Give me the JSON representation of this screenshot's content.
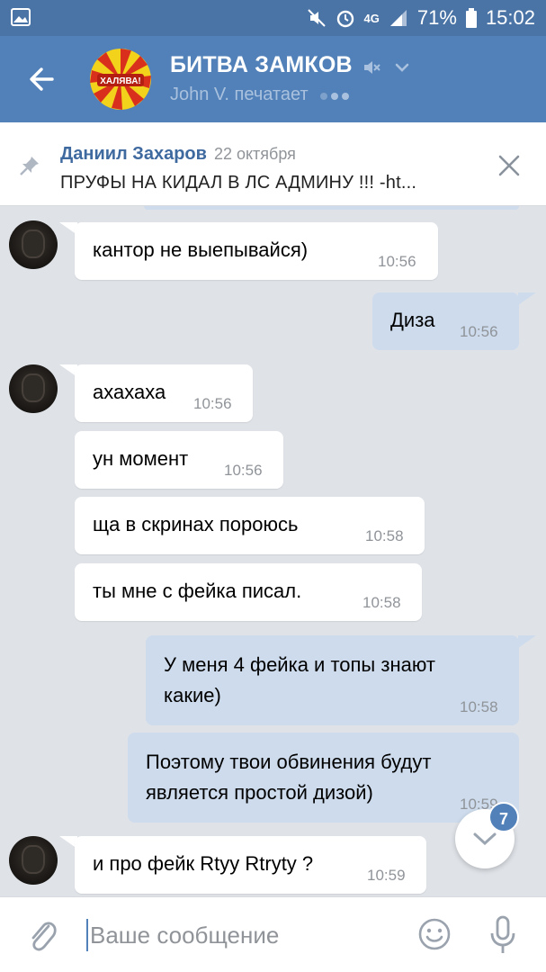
{
  "status_bar": {
    "network": "4G",
    "battery": "71%",
    "time": "15:02"
  },
  "header": {
    "title": "БИТВА ЗАМКОВ",
    "subtitle": "John V. печатает",
    "group_avatar_text": "ХАЛЯВА!"
  },
  "pinned": {
    "author": "Даниил Захаров",
    "date": "22 октября",
    "text": "ПРУФЫ НА КИДАЛ В ЛС АДМИНУ !!! -ht..."
  },
  "messages": [
    {
      "dir": "in",
      "text": "кантор не выепывайся)",
      "time": "10:56"
    },
    {
      "dir": "out",
      "text": "Диза",
      "time": "10:56"
    },
    {
      "dir": "in",
      "text": "ахахаха",
      "time": "10:56"
    },
    {
      "dir": "in",
      "text": "ун момент",
      "time": "10:56"
    },
    {
      "dir": "in",
      "text": "ща в скринах пороюсь",
      "time": "10:58"
    },
    {
      "dir": "in",
      "text": "ты мне с фейка писал.",
      "time": "10:58"
    },
    {
      "dir": "out",
      "text_line1": "У меня 4 фейка и топы знают",
      "text_line2": "какие)",
      "time": "10:58"
    },
    {
      "dir": "out",
      "text_line1": "Поэтому твои обвинения будут",
      "text_line2": "является простой дизой)",
      "time": "10:59"
    },
    {
      "dir": "in",
      "text": "и про фейк Rtyy Rtryty ?",
      "time": "10:59"
    }
  ],
  "scroll_badge": "7",
  "composer": {
    "placeholder": "Ваше сообщение"
  },
  "colors": {
    "header": "#5181b8",
    "status_bar": "#4a74a6",
    "outgoing_bubble": "#cddbec",
    "chat_bg": "#dfe3e8"
  }
}
